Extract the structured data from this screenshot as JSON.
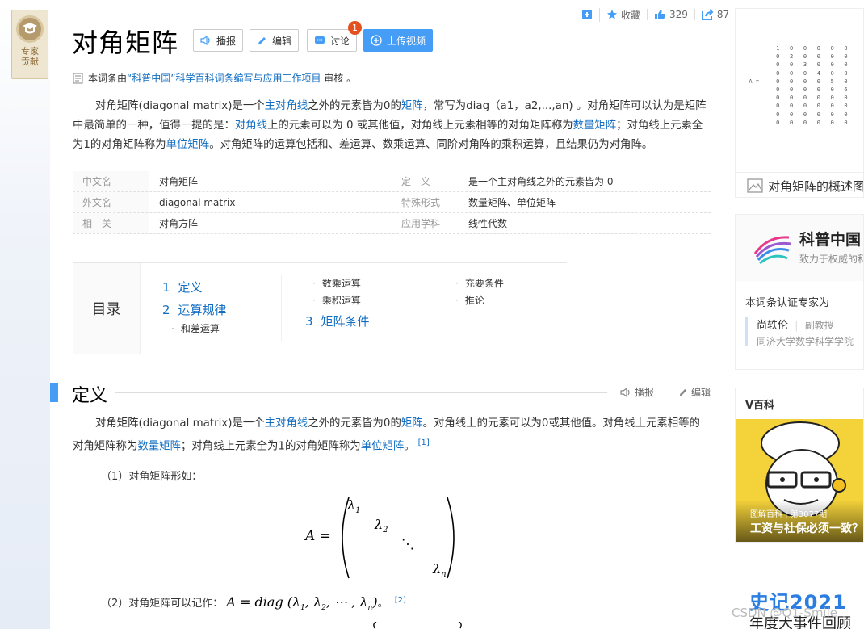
{
  "topbar": {
    "favorite_label": "收藏",
    "like_count": "329",
    "share_count": "87"
  },
  "title": "对角矩阵",
  "buttons": {
    "report": "播报",
    "edit": "编辑",
    "discuss": "讨论",
    "discuss_badge": "1",
    "upload": "上传视频"
  },
  "expert_badge": {
    "line1": "专家",
    "line2": "贡献"
  },
  "review": {
    "prefix": "本词条由",
    "org": "“科普中国”科学百科词条编写与应用工作项目",
    "suffix": "审核 。"
  },
  "intro": {
    "t1": "对角矩阵(diagonal matrix)是一个",
    "l1": "主对角线",
    "t2": "之外的元素皆为0的",
    "l2": "矩阵",
    "t3": "，常写为diag（a1，a2,...,an) 。对角矩阵可以认为是矩阵中最简单的一种，值得一提的是：",
    "l3": "对角线",
    "t4": "上的元素可以为 0 或其他值，对角线上元素相等的对角矩阵称为",
    "l4": "数量矩阵",
    "t5": "；对角线上元素全为1的对角矩阵称为",
    "l5": "单位矩阵",
    "t6": "。对角矩阵的运算包括和、差运算、数乘运算、同阶对角阵的乘积运算，且结果仍为对角阵。"
  },
  "info": [
    {
      "k": "中文名",
      "v": "对角矩阵",
      "k2": "定　义",
      "v2": "是一个主对角线之外的元素皆为 0"
    },
    {
      "k": "外文名",
      "v": "diagonal matrix",
      "k2": "特殊形式",
      "v2": "数量矩阵、单位矩阵"
    },
    {
      "k": "相　关",
      "v": "对角方阵",
      "k2": "应用学科",
      "v2": "线性代数"
    }
  ],
  "toc": {
    "heading": "目录",
    "s1_num": "1",
    "s1": "定义",
    "s2_num": "2",
    "s2": "运算规律",
    "s2a": "和差运算",
    "s2b": "数乘运算",
    "s2c": "乘积运算",
    "s3_num": "3",
    "s3": "矩阵条件",
    "s3a": "充要条件",
    "s3b": "推论"
  },
  "section1": {
    "name": "定义",
    "report": "播报",
    "edit": "编辑"
  },
  "def": {
    "t1": "对角矩阵(diagonal matrix)是一个",
    "l1": "主对角线",
    "t2": "之外的元素皆为0的",
    "l2": "矩阵",
    "t3": "。对角线上的元素可以为0或其他值。对角线上元素相等的对角矩阵称为",
    "l3": "数量矩阵",
    "t4": "；对角线上元素全为1的对角矩阵称为",
    "l4": "单位矩阵",
    "t5": "。",
    "ref": "[1]"
  },
  "item1": "（1）对角矩阵形如：",
  "item2": "（2）对角矩阵可以记作：",
  "item2_ref": "[2]",
  "item2_end": "。",
  "sidebar": {
    "album_caption": "对角矩阵的概述图",
    "kepu_title": "科普中国",
    "kepu_slogan": "致力于权威的科学传播",
    "expert_intro": "本词条认证专家为",
    "expert_name": "尚轶伦",
    "expert_title": "副教授",
    "expert_org": "同济大学数学科学学院",
    "vbaike": "V百科",
    "video_tag": "图解百科 | 第3077期",
    "video_title": "工资与社保必须一致？",
    "banner_line1": "史记2021",
    "banner_line2": "年度大事件回顾"
  },
  "watermark": "CSDN @Q1-Smile"
}
